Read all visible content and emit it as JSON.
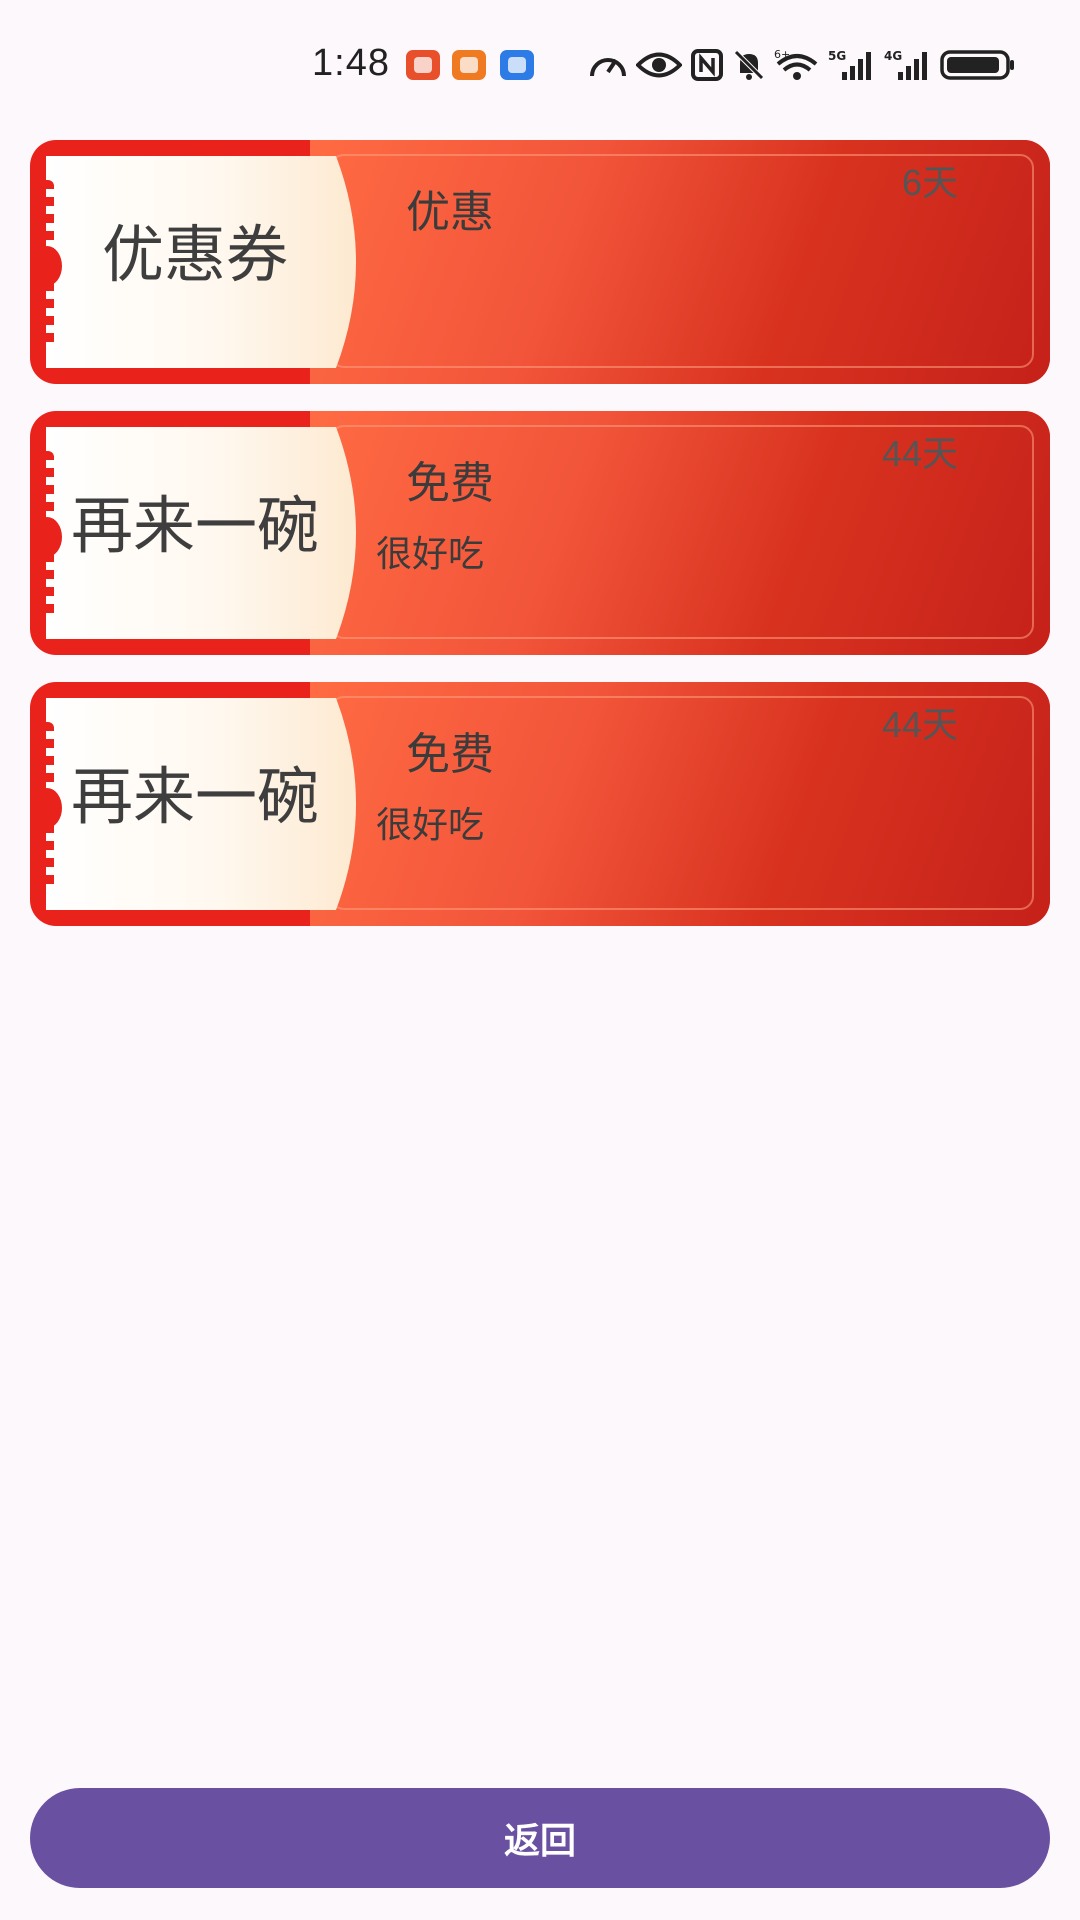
{
  "status_bar": {
    "time": "1:48",
    "icons": [
      "missed-call-icon",
      "video-app-icon",
      "blue-app-icon",
      "speed-icon",
      "eye-icon",
      "nfc-icon",
      "mute-icon",
      "wifi-6-icon",
      "signal-5g-icon",
      "signal-4g-icon",
      "battery-icon"
    ],
    "wifi_label": "6+",
    "net1_label": "5G",
    "net2_label": "4G"
  },
  "coupons": [
    {
      "title": "优惠券",
      "type": "优惠",
      "desc": "",
      "days": "6天"
    },
    {
      "title": "再来一碗",
      "type": "免费",
      "desc": "很好吃",
      "days": "44天"
    },
    {
      "title": "再来一碗",
      "type": "免费",
      "desc": "很好吃",
      "days": "44天"
    }
  ],
  "back_button": {
    "label": "返回"
  },
  "colors": {
    "coupon_frame": "#e9231c",
    "button_bg": "#6a50a1",
    "page_bg": "#fdf8fb"
  }
}
